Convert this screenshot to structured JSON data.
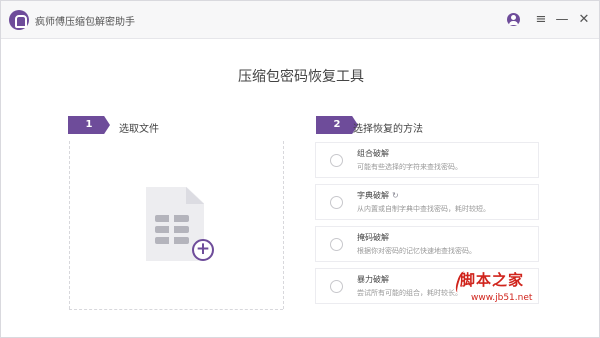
{
  "app": {
    "title": "疯师傅压缩包解密助手",
    "accent_color": "#6e4c9a"
  },
  "titlebar": {
    "icons": [
      "user-icon",
      "menu-icon",
      "minimize-icon",
      "close-icon"
    ],
    "menu_glyph": "≡",
    "minimize_glyph": "—",
    "close_glyph": "✕"
  },
  "main": {
    "title": "压缩包密码恢复工具",
    "step1": {
      "number": "1",
      "label": "选取文件",
      "add_glyph": "+"
    },
    "step2": {
      "number": "2",
      "label": "选择恢复的方法"
    },
    "methods": [
      {
        "title": "组合破解",
        "desc": "可能有些选择的字符来查找密码。"
      },
      {
        "title": "字典破解",
        "desc": "从内置或自制字典中查找密码，耗时较短。",
        "help_icon": "help-icon",
        "help_glyph": "↻"
      },
      {
        "title": "掩码破解",
        "desc": "根据你对密码的记忆快速地查找密码。"
      },
      {
        "title": "暴力破解",
        "desc": "尝试所有可能的组合，耗时较长。"
      }
    ]
  },
  "watermark": {
    "main": "脚本之家",
    "url": "www.jb51.net",
    "color": "#d0241c"
  }
}
